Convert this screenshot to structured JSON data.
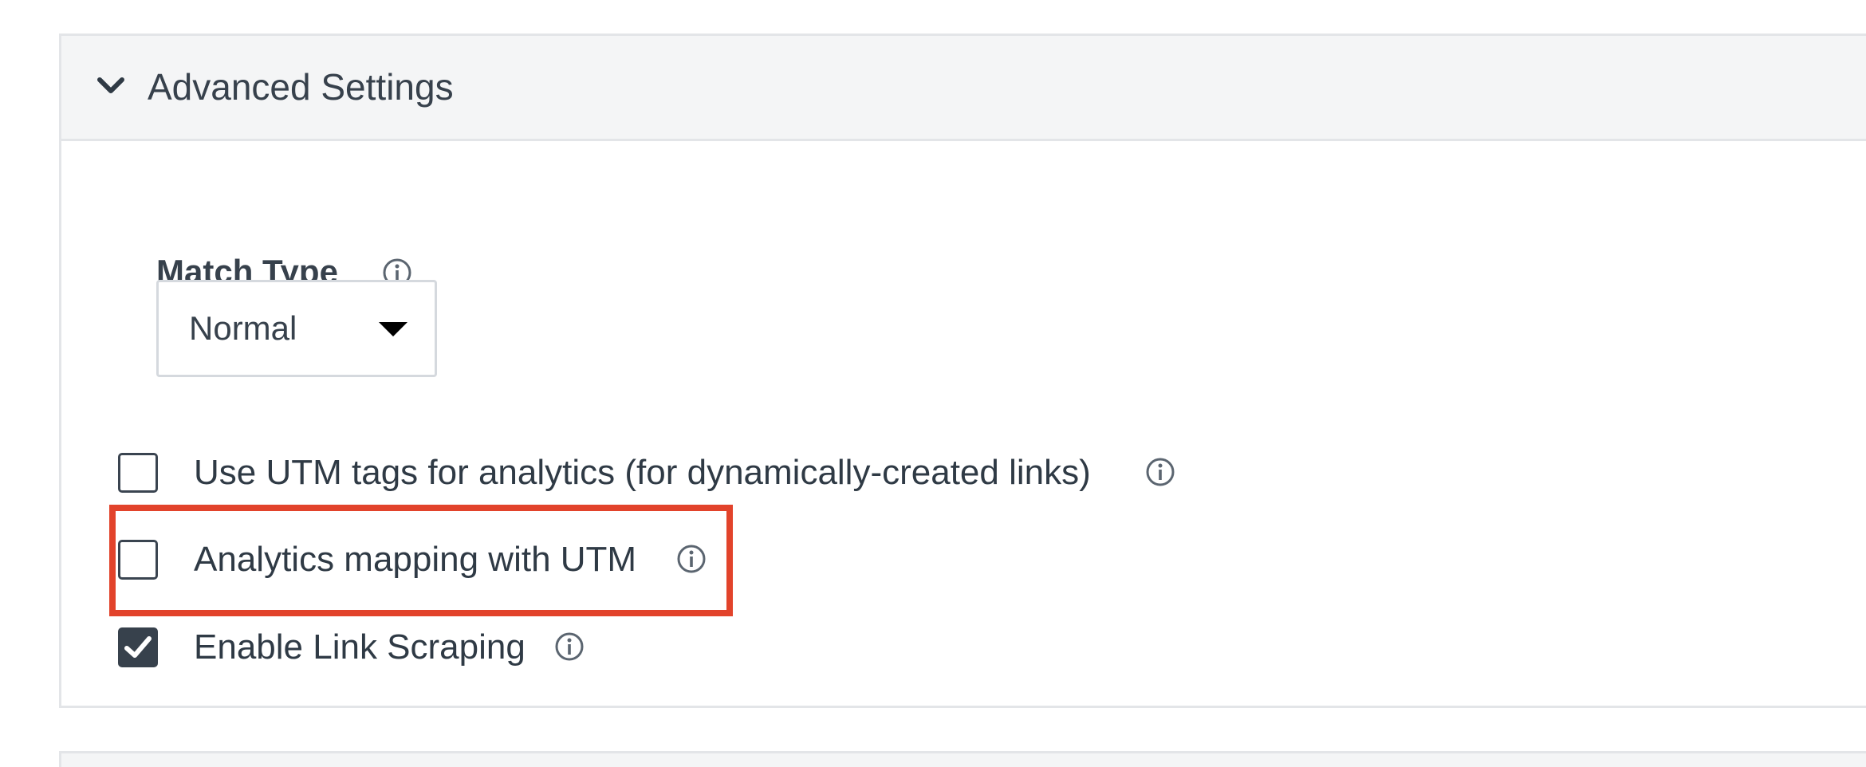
{
  "advanced_settings": {
    "title": "Advanced Settings",
    "expanded": true,
    "toggle_icon": "chevron-down-icon"
  },
  "match_type": {
    "label": "Match Type",
    "info_icon": "info-icon",
    "selected": "Normal",
    "caret_icon": "caret-down-icon"
  },
  "options": [
    {
      "label": "Use UTM tags for analytics (for dynamically-created links)",
      "checked": false,
      "info_icon": "info-icon"
    },
    {
      "label": "Analytics mapping with UTM",
      "checked": false,
      "info_icon": "info-icon",
      "highlighted": true
    },
    {
      "label": "Enable Link Scraping",
      "checked": true,
      "info_icon": "info-icon"
    }
  ],
  "colors": {
    "highlight": "#e2432b",
    "checkbox_checked": "#37414c",
    "header_bg": "#f4f5f6",
    "border": "#e3e5e8",
    "text": "#2f3a45"
  }
}
